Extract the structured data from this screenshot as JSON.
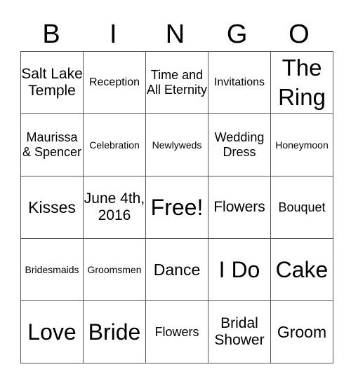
{
  "header": [
    "B",
    "I",
    "N",
    "G",
    "O"
  ],
  "rows": [
    [
      "Salt Lake Temple",
      "Reception",
      "Time and All Eternity",
      "Invitations",
      "The Ring"
    ],
    [
      "Maurissa & Spencer",
      "Celebration",
      "Newlyweds",
      "Wedding Dress",
      "Honeymoon"
    ],
    [
      "Kisses",
      "June 4th, 2016",
      "Free!",
      "Flowers",
      "Bouquet"
    ],
    [
      "Bridesmaids",
      "Groomsmen",
      "Dance",
      "I Do",
      "Cake"
    ],
    [
      "Love",
      "Bride",
      "Flowers",
      "Bridal Shower",
      "Groom"
    ]
  ]
}
